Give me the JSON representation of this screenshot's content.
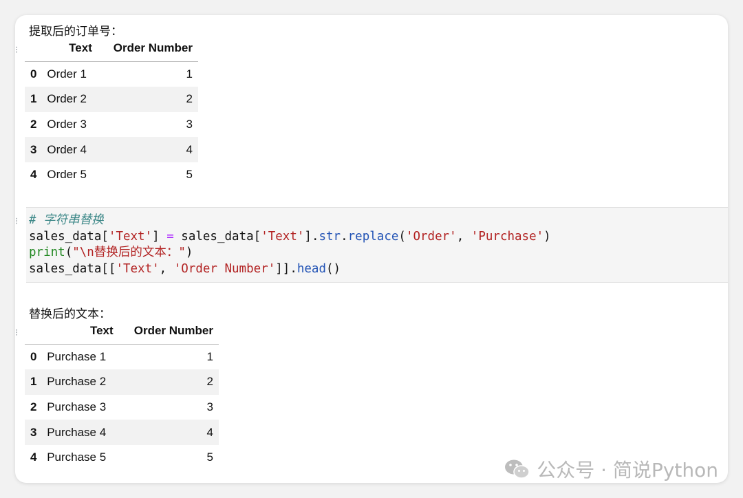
{
  "output1": {
    "label": "提取后的订单号：",
    "columns": [
      "Text",
      "Order Number"
    ],
    "rows": [
      {
        "index": "0",
        "text": "Order 1",
        "num": "1"
      },
      {
        "index": "1",
        "text": "Order 2",
        "num": "2"
      },
      {
        "index": "2",
        "text": "Order 3",
        "num": "3"
      },
      {
        "index": "3",
        "text": "Order 4",
        "num": "4"
      },
      {
        "index": "4",
        "text": "Order 5",
        "num": "5"
      }
    ]
  },
  "code_cell": {
    "comment": "# 字符串替换",
    "line2": {
      "a": "sales_data[",
      "s1": "'Text'",
      "b": "] ",
      "op": "=",
      "c": " sales_data[",
      "s2": "'Text'",
      "d": "].",
      "attr1": "str",
      "e": ".",
      "attr2": "replace",
      "f": "(",
      "s3": "'Order'",
      "g": ", ",
      "s4": "'Purchase'",
      "h": ")"
    },
    "line3": {
      "fn": "print",
      "a": "(",
      "s1": "\"\\n替换后的文本：\"",
      "b": ")"
    },
    "line4": {
      "a": "sales_data[[",
      "s1": "'Text'",
      "b": ", ",
      "s2": "'Order Number'",
      "c": "]].",
      "attr1": "head",
      "d": "()"
    }
  },
  "output2": {
    "label": "替换后的文本：",
    "columns": [
      "Text",
      "Order Number"
    ],
    "rows": [
      {
        "index": "0",
        "text": "Purchase 1",
        "num": "1"
      },
      {
        "index": "1",
        "text": "Purchase 2",
        "num": "2"
      },
      {
        "index": "2",
        "text": "Purchase 3",
        "num": "3"
      },
      {
        "index": "3",
        "text": "Purchase 4",
        "num": "4"
      },
      {
        "index": "4",
        "text": "Purchase 5",
        "num": "5"
      }
    ]
  },
  "watermark": {
    "text": "公众号 · 简说Python",
    "icon": "wechat-icon"
  }
}
